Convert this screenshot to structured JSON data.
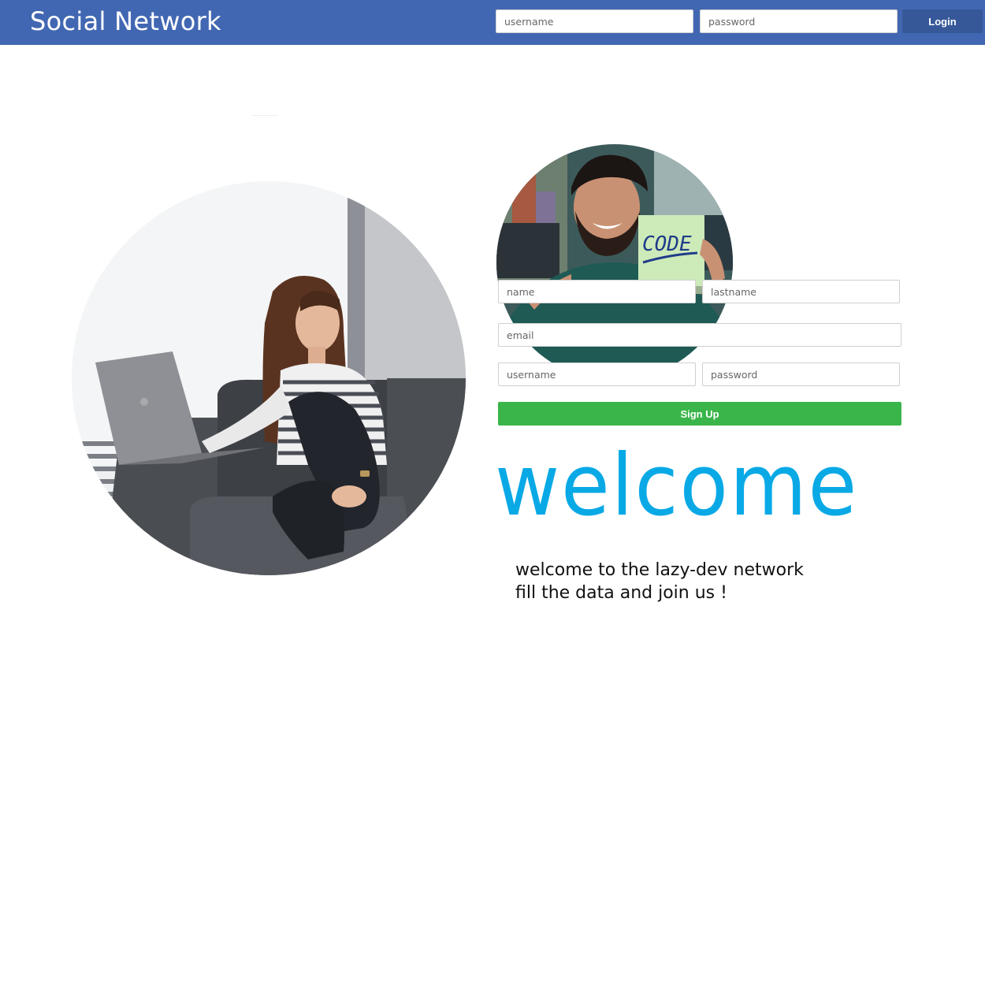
{
  "header": {
    "brand": "Social Network",
    "username_placeholder": "username",
    "password_placeholder": "password",
    "login_label": "Login"
  },
  "signup": {
    "name_placeholder": "name",
    "lastname_placeholder": "lastname",
    "email_placeholder": "email",
    "username_placeholder": "username",
    "password_placeholder": "password",
    "signup_label": "Sign Up",
    "sticky_note_text": "CODE"
  },
  "welcome": {
    "heading": "welcome",
    "line1": "welcome to the lazy-dev network",
    "line2": "fill the data and join us !"
  },
  "colors": {
    "header_bg": "#4267b2",
    "login_button": "#365899",
    "signup_button": "#3ab54a",
    "welcome_accent": "#09a9e6"
  }
}
